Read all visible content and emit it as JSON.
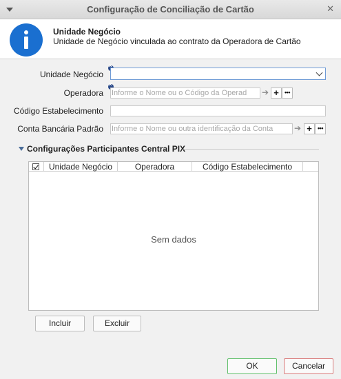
{
  "window": {
    "title": "Configuração de Conciliação de Cartão",
    "close_symbol": "✕"
  },
  "header": {
    "icon": "info-icon",
    "title": "Unidade Negócio",
    "subtitle": "Unidade de Negócio vinculada ao contrato da Operadora de Cartão",
    "accent_color": "#1a6fd0"
  },
  "form": {
    "unidade_negocio": {
      "label": "Unidade Negócio",
      "value": ""
    },
    "operadora": {
      "label": "Operadora",
      "placeholder": "Informe o Nome ou o Código da Operad"
    },
    "codigo_estabelecimento": {
      "label": "Código Estabelecimento",
      "value": ""
    },
    "conta_bancaria": {
      "label": "Conta Bancária Padrão",
      "placeholder": "Informe o Nome ou outra identificação da Conta"
    }
  },
  "section": {
    "title": "Configurações Participantes Central PIX"
  },
  "grid": {
    "columns": [
      "Unidade Negócio",
      "Operadora",
      "Código Estabelecimento"
    ],
    "empty_text": "Sem dados"
  },
  "buttons": {
    "incluir": "Incluir",
    "excluir": "Excluir",
    "ok": "OK",
    "cancelar": "Cancelar",
    "add_symbol": "+",
    "more_symbol": "•••",
    "go_symbol": "➔"
  }
}
